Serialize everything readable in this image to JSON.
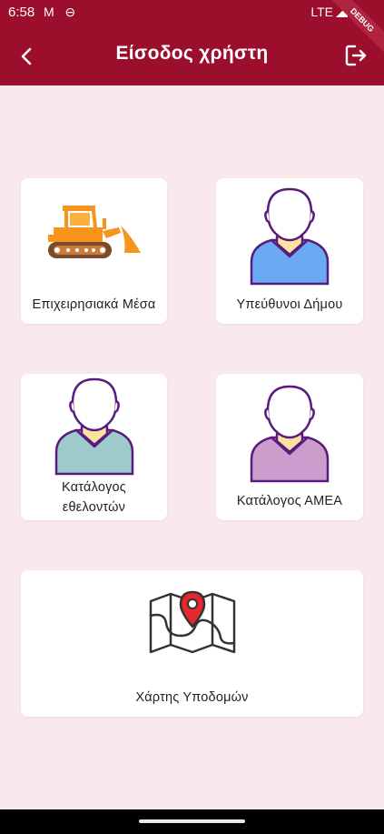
{
  "status": {
    "time": "6:58",
    "icons": "M ⊖",
    "network": "LTE",
    "debug": "DEBUG"
  },
  "appbar": {
    "title": "Είσοδος χρήστη"
  },
  "cards": {
    "equipment": {
      "label": "Επιχειρησιακά Μέσα",
      "icon": "bulldozer-icon"
    },
    "officials": {
      "label": "Υπεύθυνοι Δήμου",
      "icon": "person-blue-icon"
    },
    "volunteers": {
      "label_line1": "Κατάλογος",
      "label_line2": "εθελοντών",
      "icon": "person-teal-icon"
    },
    "disabled": {
      "label": "Κατάλογος ΑΜΕΑ",
      "icon": "person-purple-icon"
    },
    "map": {
      "label": "Χάρτης Υποδομών",
      "icon": "map-pin-icon"
    }
  },
  "colors": {
    "primary": "#9b0e2c",
    "background": "#f9e8ec",
    "bulldozer": "#f7941d",
    "shirt_blue": "#6aaaf2",
    "shirt_teal": "#9ecacc",
    "shirt_purple": "#cb9ccc",
    "outline": "#5a1b7e",
    "pin": "#e8262d"
  }
}
